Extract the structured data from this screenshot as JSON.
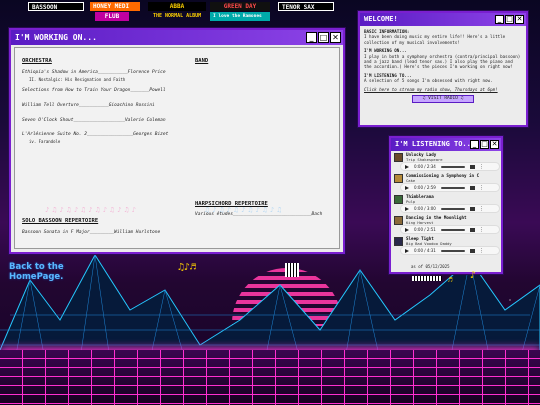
{
  "banner": {
    "tags": [
      "BASSOON",
      "HONEY MEDI",
      "ABBA",
      "GREEN DAY",
      "TENOR SAX"
    ],
    "line2": [
      "THE NORMAL ALBUM"
    ],
    "small_tags": [
      "FLUB",
      "I love the Ramones"
    ]
  },
  "main_window": {
    "title": "I'M WORKING ON...",
    "orchestra": {
      "heading": "ORCHESTRA",
      "items": [
        {
          "text": "Ethiopia's Shadow in America___________Florence Price",
          "subs": [
            "II. Nostalgic: His Resignation and Faith"
          ]
        },
        {
          "text": "Selections from How to Train Your Dragon_______Powell",
          "subs": []
        },
        {
          "text": "William Tell Overture___________Gioachino Rossini",
          "subs": []
        },
        {
          "text": "Seven O'Clock Shout___________________Valerie Coleman",
          "subs": []
        },
        {
          "text": "L'Arlésienne Suite No. 2_________________Georges Bizet",
          "subs": [
            "iv. Farandole"
          ]
        }
      ]
    },
    "band": {
      "heading": "BAND"
    },
    "harpsichord": {
      "heading": "HARPSICHORD REPERTOIRE",
      "items": [
        "Various études_____________________________Bach"
      ]
    },
    "solo_bassoon": {
      "heading": "SOLO BASSOON REPERTOIRE",
      "items": [
        "Bassoon Sonata in F Major_________William Hurlstone"
      ]
    }
  },
  "welcome_window": {
    "title": "WELCOME!",
    "basic_heading": "BASIC INFORMATION:",
    "basic_text": "I have been doing music my entire life!! Here's a little collection of my musical involvements!",
    "working_heading": "I'M WORKING ON...",
    "working_text": "I play in both a symphony orchestra (contra/principal bassoon) and a jazz band (lead tenor sax.) I also play the piano and the accordion.) Here's the pieces I'm working on right now!",
    "listening_heading": "I'M LISTENING TO...",
    "listening_text": "A selection of 5 songs I'm obsessed with right now.",
    "radio_text": "Click here to stream my radio show, Thursdays at 6pm!",
    "visit_button": "♫ VISIT RADIO ♫"
  },
  "listening_window": {
    "title": "I'M LISTENING TO...",
    "songs": [
      {
        "title": "Unlucky Lady",
        "artist": "Trip Shakespeare",
        "time": "0:00 / 2:34"
      },
      {
        "title": "Commissioning a Symphony in C",
        "artist": "Cake",
        "time": "0:00 / 2:59"
      },
      {
        "title": "Thimblerama",
        "artist": "Pulp",
        "time": "0:00 / 3:00"
      },
      {
        "title": "Dancing in the Moonlight",
        "artist": "King Harvest",
        "time": "0:00 / 2:51"
      },
      {
        "title": "Sleep Tight",
        "artist": "Big Bad Voodoo Daddy",
        "time": "0:00 / 4:31"
      }
    ],
    "as_of": "as of 05/12/2025"
  },
  "back_link": {
    "line1": "Back to the",
    "line2": "HomePage."
  },
  "colors": {
    "accent": "#7a1fd0",
    "title_bar": "#5a1cc4",
    "neon_grid": "#ff2fd0",
    "link": "#59b8ff"
  }
}
